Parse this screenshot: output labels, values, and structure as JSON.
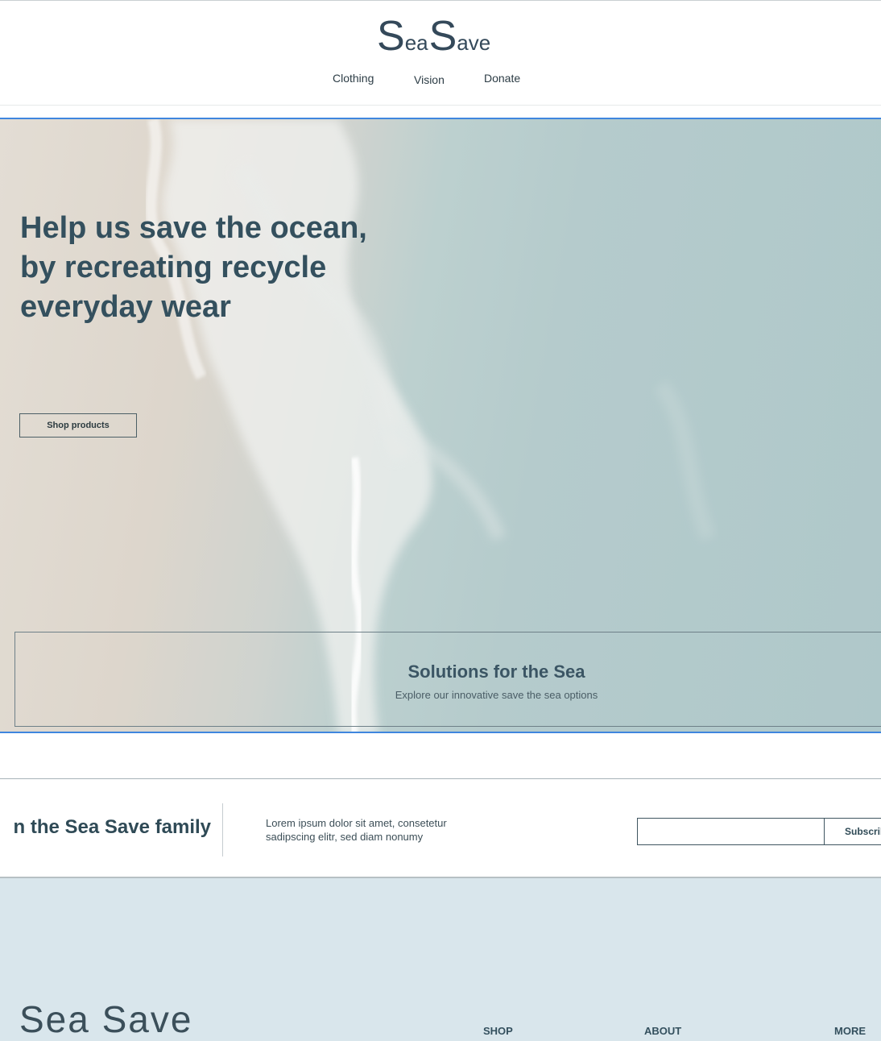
{
  "brand": {
    "logo_big_1": "S",
    "logo_small_1": "ea",
    "logo_big_2": "S",
    "logo_small_2": "ave"
  },
  "nav": {
    "items": [
      "Clothing",
      "Vision",
      "Donate"
    ]
  },
  "hero": {
    "title": "Help us save the ocean, by recreating recycle everyday wear",
    "cta": "Shop products"
  },
  "solutions": {
    "title": "Solutions for the Sea",
    "subtitle": "Explore our innovative save the sea options"
  },
  "newsletter": {
    "heading": "n the Sea Save family",
    "text": "Lorem ipsum dolor sit amet, consetetur sadipscing elitr, sed diam nonumy",
    "email_value": "",
    "subscribe_label": "Subscribe"
  },
  "footer": {
    "logo": "Sea Save",
    "columns": [
      "SHOP",
      "ABOUT",
      "MORE"
    ]
  },
  "colors": {
    "accent_border": "#3f86de",
    "footer_bg": "#d9e6ec",
    "text": "#2f4a56"
  }
}
